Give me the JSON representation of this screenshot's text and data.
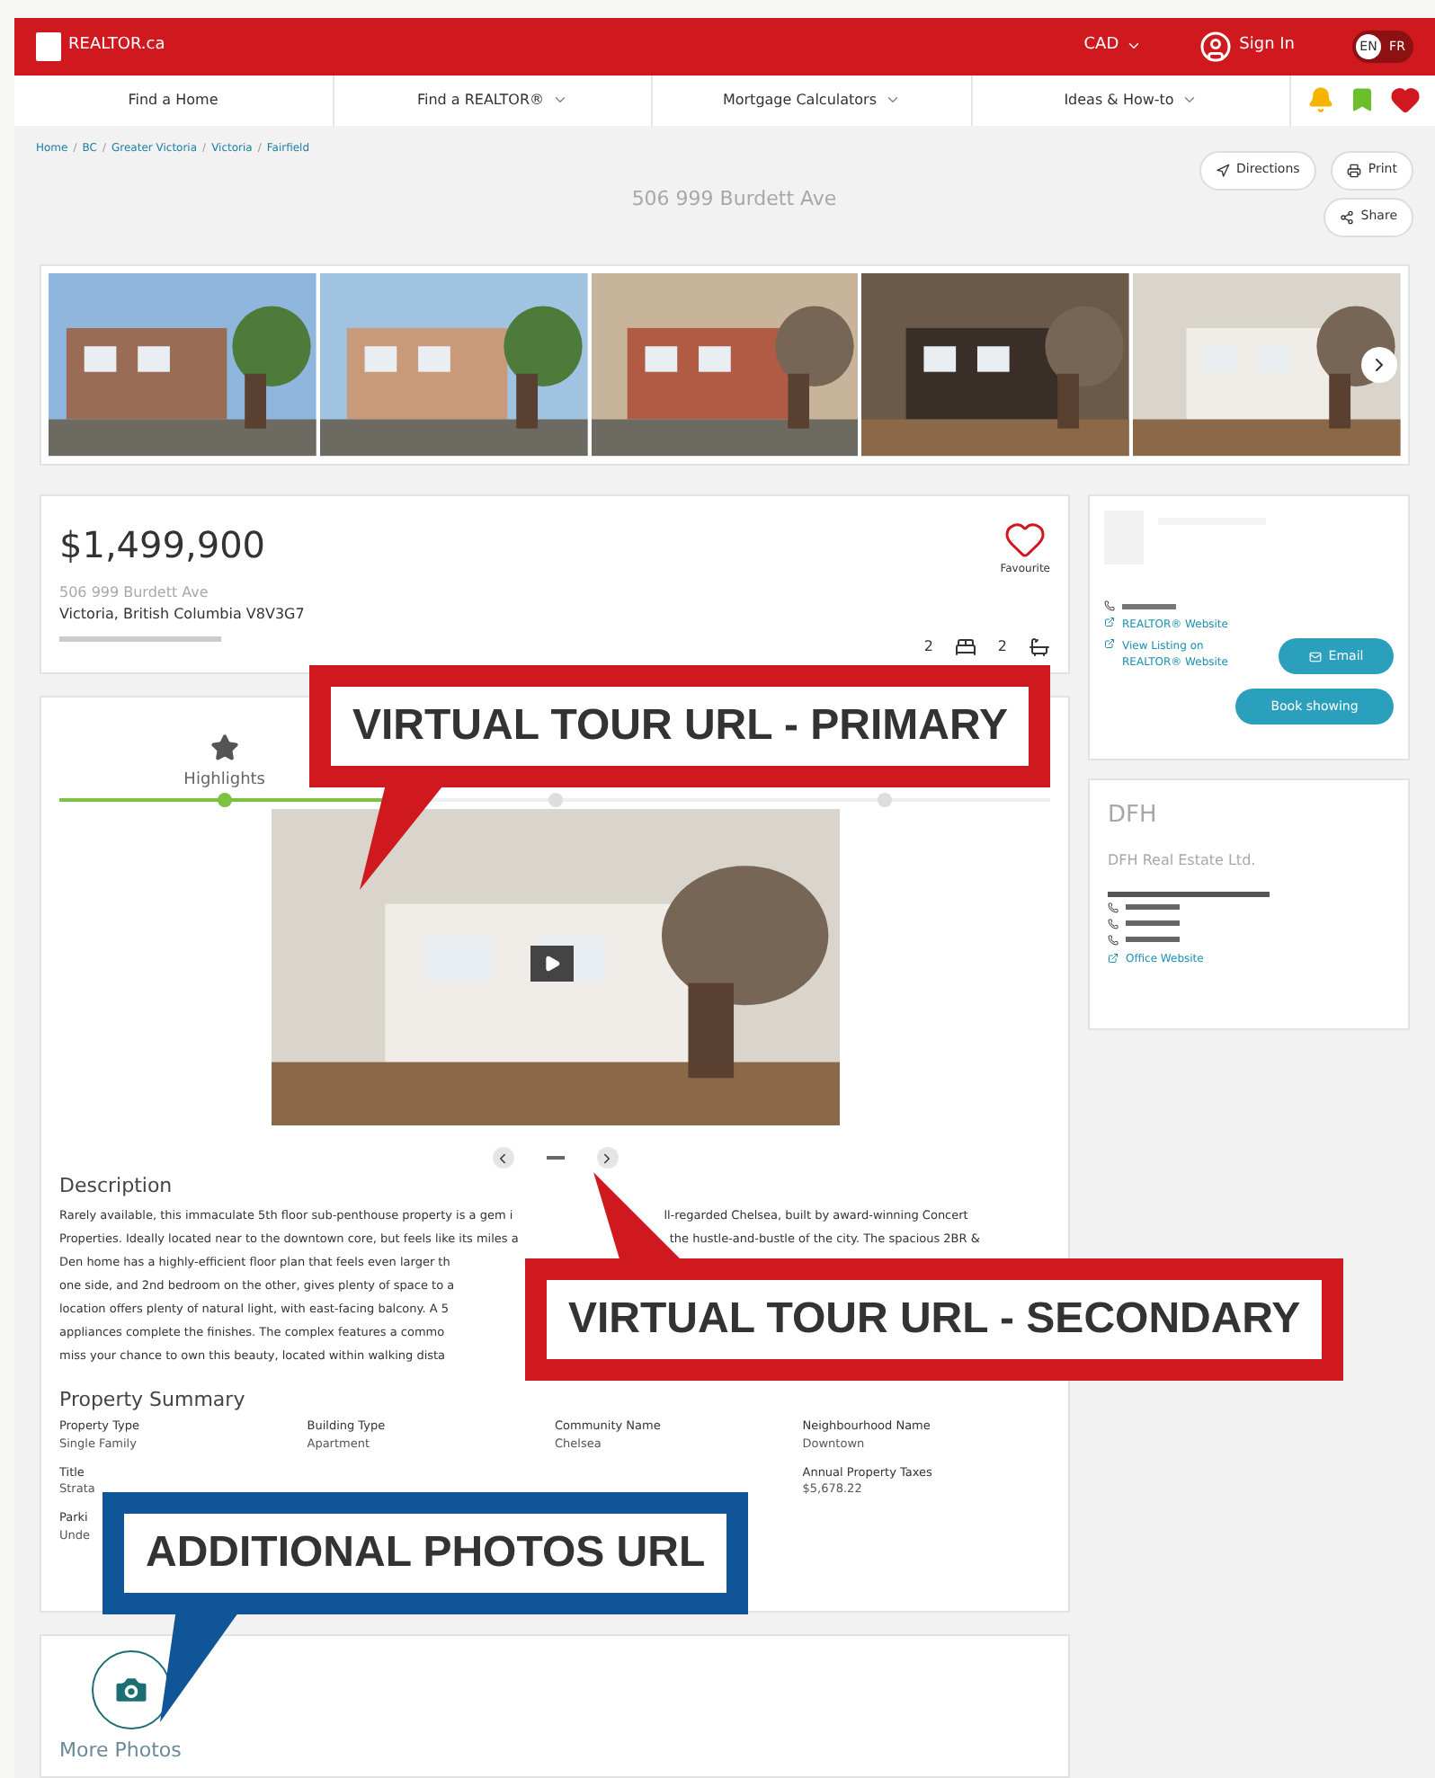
{
  "header": {
    "logo": "REALTOR.ca",
    "currency": "CAD",
    "sign_in": "Sign In",
    "language": [
      {
        "label": "EN",
        "selected": true
      },
      {
        "label": "FR",
        "selected": false
      }
    ]
  },
  "nav": {
    "items": [
      "Find a Home",
      "Find a REALTOR®",
      "Mortgage Calculators",
      "Ideas & How-to"
    ],
    "dropdown": [
      false,
      true,
      true,
      true
    ]
  },
  "breadcrumb": {
    "separator": "/",
    "items": [
      "Home",
      "BC",
      "Greater Victoria",
      "Victoria",
      "Fairfield"
    ]
  },
  "title": "506 999 Burdett Ave",
  "actions": [
    "Directions",
    "Print",
    "Share"
  ],
  "photos": [
    {
      "kind": "picture"
    },
    {
      "kind": "picture"
    },
    {
      "kind": "picture"
    },
    {
      "kind": "picture"
    },
    {
      "kind": "picture"
    }
  ],
  "listing": {
    "price": "$1,499,900",
    "address": "506 999 Burdett Ave",
    "city": "Victoria, British Columbia V8V3G7",
    "favourite": "Favourite",
    "bedrooms": "2",
    "bathrooms": "2"
  },
  "tabs": [
    {
      "label": "Highlights",
      "selected": true
    },
    {
      "selected": false
    },
    {
      "selected": false
    }
  ],
  "video": {
    "kind": "picture"
  },
  "description": {
    "heading": "Description",
    "lines": [
      [
        "Rarely available, this immaculate 5th floor sub-penthouse property is a gem i",
        "ll-regarded Chelsea, built by award-winning Concert"
      ],
      [
        "Properties. Ideally located near to the downtown core, but feels like its miles a",
        "the hustle-and-bustle of the city. The spacious 2BR &"
      ],
      [
        "Den home has a highly-efficient floor plan that feels even larger th"
      ],
      [
        "one side, and 2nd bedroom on the other, gives plenty of space to a"
      ],
      [
        "location offers plenty of natural light, with east-facing balcony. A 5"
      ],
      [
        "appliances complete the finishes. The complex features a commo"
      ],
      [
        "miss your chance to own this beauty, located within walking dista"
      ]
    ]
  },
  "summary": {
    "heading": "Property Summary",
    "fields": [
      {
        "label": "Property Type",
        "value": "Single Family"
      },
      {
        "label": "Building Type",
        "value": "Apartment"
      },
      {
        "label": "Community Name",
        "value": "Chelsea"
      },
      {
        "label": "Neighbourhood Name",
        "value": "Downtown"
      },
      {
        "label": "Title",
        "value": "Strata"
      },
      {
        "label": "Annual Property Taxes",
        "value": "$5,678.22"
      },
      {
        "label": "Parki",
        "value": "Unde"
      }
    ]
  },
  "more_photos": "More Photos",
  "agent": {
    "links": [
      "REALTOR® Website",
      "View Listing on REALTOR® Website"
    ],
    "buttons": [
      "Email",
      "Book showing"
    ]
  },
  "brokerage": {
    "logo": "DFH",
    "name": "DFH Real Estate Ltd.",
    "link": "Office Website"
  },
  "callouts": [
    {
      "text": "VIRTUAL TOUR URL - PRIMARY",
      "color": "#d0191f"
    },
    {
      "text": "VIRTUAL TOUR URL - SECONDARY",
      "color": "#d0191f"
    },
    {
      "text": "ADDITIONAL PHOTOS URL",
      "color": "#0f5597"
    }
  ]
}
